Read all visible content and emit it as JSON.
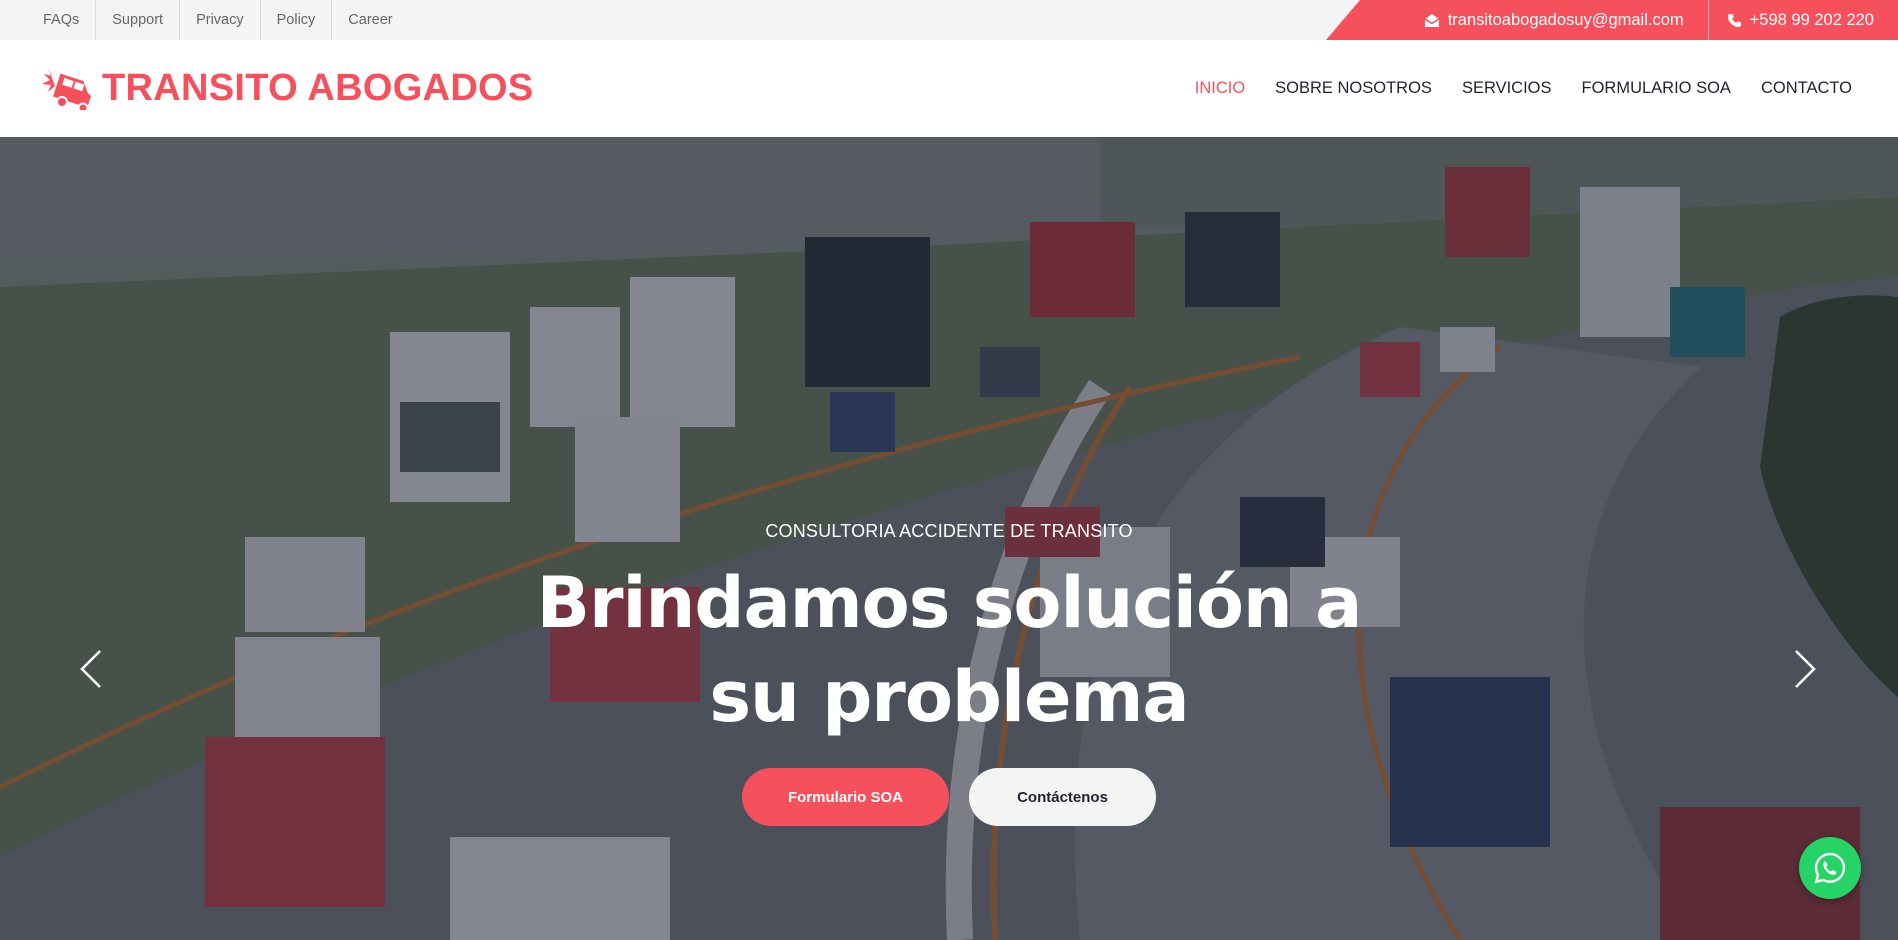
{
  "topbar": {
    "links": [
      {
        "label": "FAQs"
      },
      {
        "label": "Support"
      },
      {
        "label": "Privacy"
      },
      {
        "label": "Policy"
      },
      {
        "label": "Career"
      }
    ],
    "email": "transitoabogadosuy@gmail.com",
    "phone": "+598 99 202 220"
  },
  "header": {
    "logo_text": "TRANSITO ABOGADOS",
    "logo_icon": "car-crash-icon",
    "nav": [
      {
        "label": "INICIO",
        "active": true
      },
      {
        "label": "SOBRE NOSOTROS"
      },
      {
        "label": "SERVICIOS"
      },
      {
        "label": "FORMULARIO SOA"
      },
      {
        "label": "CONTACTO"
      }
    ]
  },
  "hero": {
    "kicker": "CONSULTORIA ACCIDENTE DE TRANSITO",
    "title": "Brindamos solución a su problema",
    "primary_button": "Formulario SOA",
    "secondary_button": "Contáctenos",
    "prev_icon": "chevron-left-icon",
    "next_icon": "chevron-right-icon"
  },
  "floating": {
    "whatsapp_icon": "whatsapp-icon"
  },
  "colors": {
    "accent": "#f5505c",
    "dark": "#1f2231",
    "topbar_bg": "#f4f4f4",
    "whatsapp": "#25d366"
  }
}
